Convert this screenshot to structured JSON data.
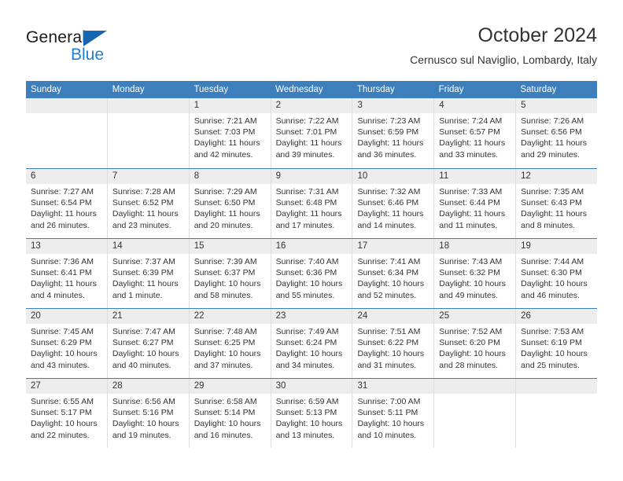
{
  "brand": {
    "name_dark": "General",
    "name_blue": "Blue",
    "accent_color": "#1565b0",
    "blue_color": "#1e7fd4"
  },
  "header": {
    "title": "October 2024",
    "subtitle": "Cernusco sul Naviglio, Lombardy, Italy"
  },
  "calendar": {
    "header_bg": "#3d7ebd",
    "daynum_bg": "#ededed",
    "weekday_headers": [
      "Sunday",
      "Monday",
      "Tuesday",
      "Wednesday",
      "Thursday",
      "Friday",
      "Saturday"
    ],
    "weeks": [
      [
        {
          "day": "",
          "sunrise": "",
          "sunset": "",
          "daylight1": "",
          "daylight2": ""
        },
        {
          "day": "",
          "sunrise": "",
          "sunset": "",
          "daylight1": "",
          "daylight2": ""
        },
        {
          "day": "1",
          "sunrise": "Sunrise: 7:21 AM",
          "sunset": "Sunset: 7:03 PM",
          "daylight1": "Daylight: 11 hours",
          "daylight2": "and 42 minutes."
        },
        {
          "day": "2",
          "sunrise": "Sunrise: 7:22 AM",
          "sunset": "Sunset: 7:01 PM",
          "daylight1": "Daylight: 11 hours",
          "daylight2": "and 39 minutes."
        },
        {
          "day": "3",
          "sunrise": "Sunrise: 7:23 AM",
          "sunset": "Sunset: 6:59 PM",
          "daylight1": "Daylight: 11 hours",
          "daylight2": "and 36 minutes."
        },
        {
          "day": "4",
          "sunrise": "Sunrise: 7:24 AM",
          "sunset": "Sunset: 6:57 PM",
          "daylight1": "Daylight: 11 hours",
          "daylight2": "and 33 minutes."
        },
        {
          "day": "5",
          "sunrise": "Sunrise: 7:26 AM",
          "sunset": "Sunset: 6:56 PM",
          "daylight1": "Daylight: 11 hours",
          "daylight2": "and 29 minutes."
        }
      ],
      [
        {
          "day": "6",
          "sunrise": "Sunrise: 7:27 AM",
          "sunset": "Sunset: 6:54 PM",
          "daylight1": "Daylight: 11 hours",
          "daylight2": "and 26 minutes."
        },
        {
          "day": "7",
          "sunrise": "Sunrise: 7:28 AM",
          "sunset": "Sunset: 6:52 PM",
          "daylight1": "Daylight: 11 hours",
          "daylight2": "and 23 minutes."
        },
        {
          "day": "8",
          "sunrise": "Sunrise: 7:29 AM",
          "sunset": "Sunset: 6:50 PM",
          "daylight1": "Daylight: 11 hours",
          "daylight2": "and 20 minutes."
        },
        {
          "day": "9",
          "sunrise": "Sunrise: 7:31 AM",
          "sunset": "Sunset: 6:48 PM",
          "daylight1": "Daylight: 11 hours",
          "daylight2": "and 17 minutes."
        },
        {
          "day": "10",
          "sunrise": "Sunrise: 7:32 AM",
          "sunset": "Sunset: 6:46 PM",
          "daylight1": "Daylight: 11 hours",
          "daylight2": "and 14 minutes."
        },
        {
          "day": "11",
          "sunrise": "Sunrise: 7:33 AM",
          "sunset": "Sunset: 6:44 PM",
          "daylight1": "Daylight: 11 hours",
          "daylight2": "and 11 minutes."
        },
        {
          "day": "12",
          "sunrise": "Sunrise: 7:35 AM",
          "sunset": "Sunset: 6:43 PM",
          "daylight1": "Daylight: 11 hours",
          "daylight2": "and 8 minutes."
        }
      ],
      [
        {
          "day": "13",
          "sunrise": "Sunrise: 7:36 AM",
          "sunset": "Sunset: 6:41 PM",
          "daylight1": "Daylight: 11 hours",
          "daylight2": "and 4 minutes."
        },
        {
          "day": "14",
          "sunrise": "Sunrise: 7:37 AM",
          "sunset": "Sunset: 6:39 PM",
          "daylight1": "Daylight: 11 hours",
          "daylight2": "and 1 minute."
        },
        {
          "day": "15",
          "sunrise": "Sunrise: 7:39 AM",
          "sunset": "Sunset: 6:37 PM",
          "daylight1": "Daylight: 10 hours",
          "daylight2": "and 58 minutes."
        },
        {
          "day": "16",
          "sunrise": "Sunrise: 7:40 AM",
          "sunset": "Sunset: 6:36 PM",
          "daylight1": "Daylight: 10 hours",
          "daylight2": "and 55 minutes."
        },
        {
          "day": "17",
          "sunrise": "Sunrise: 7:41 AM",
          "sunset": "Sunset: 6:34 PM",
          "daylight1": "Daylight: 10 hours",
          "daylight2": "and 52 minutes."
        },
        {
          "day": "18",
          "sunrise": "Sunrise: 7:43 AM",
          "sunset": "Sunset: 6:32 PM",
          "daylight1": "Daylight: 10 hours",
          "daylight2": "and 49 minutes."
        },
        {
          "day": "19",
          "sunrise": "Sunrise: 7:44 AM",
          "sunset": "Sunset: 6:30 PM",
          "daylight1": "Daylight: 10 hours",
          "daylight2": "and 46 minutes."
        }
      ],
      [
        {
          "day": "20",
          "sunrise": "Sunrise: 7:45 AM",
          "sunset": "Sunset: 6:29 PM",
          "daylight1": "Daylight: 10 hours",
          "daylight2": "and 43 minutes."
        },
        {
          "day": "21",
          "sunrise": "Sunrise: 7:47 AM",
          "sunset": "Sunset: 6:27 PM",
          "daylight1": "Daylight: 10 hours",
          "daylight2": "and 40 minutes."
        },
        {
          "day": "22",
          "sunrise": "Sunrise: 7:48 AM",
          "sunset": "Sunset: 6:25 PM",
          "daylight1": "Daylight: 10 hours",
          "daylight2": "and 37 minutes."
        },
        {
          "day": "23",
          "sunrise": "Sunrise: 7:49 AM",
          "sunset": "Sunset: 6:24 PM",
          "daylight1": "Daylight: 10 hours",
          "daylight2": "and 34 minutes."
        },
        {
          "day": "24",
          "sunrise": "Sunrise: 7:51 AM",
          "sunset": "Sunset: 6:22 PM",
          "daylight1": "Daylight: 10 hours",
          "daylight2": "and 31 minutes."
        },
        {
          "day": "25",
          "sunrise": "Sunrise: 7:52 AM",
          "sunset": "Sunset: 6:20 PM",
          "daylight1": "Daylight: 10 hours",
          "daylight2": "and 28 minutes."
        },
        {
          "day": "26",
          "sunrise": "Sunrise: 7:53 AM",
          "sunset": "Sunset: 6:19 PM",
          "daylight1": "Daylight: 10 hours",
          "daylight2": "and 25 minutes."
        }
      ],
      [
        {
          "day": "27",
          "sunrise": "Sunrise: 6:55 AM",
          "sunset": "Sunset: 5:17 PM",
          "daylight1": "Daylight: 10 hours",
          "daylight2": "and 22 minutes."
        },
        {
          "day": "28",
          "sunrise": "Sunrise: 6:56 AM",
          "sunset": "Sunset: 5:16 PM",
          "daylight1": "Daylight: 10 hours",
          "daylight2": "and 19 minutes."
        },
        {
          "day": "29",
          "sunrise": "Sunrise: 6:58 AM",
          "sunset": "Sunset: 5:14 PM",
          "daylight1": "Daylight: 10 hours",
          "daylight2": "and 16 minutes."
        },
        {
          "day": "30",
          "sunrise": "Sunrise: 6:59 AM",
          "sunset": "Sunset: 5:13 PM",
          "daylight1": "Daylight: 10 hours",
          "daylight2": "and 13 minutes."
        },
        {
          "day": "31",
          "sunrise": "Sunrise: 7:00 AM",
          "sunset": "Sunset: 5:11 PM",
          "daylight1": "Daylight: 10 hours",
          "daylight2": "and 10 minutes."
        },
        {
          "day": "",
          "sunrise": "",
          "sunset": "",
          "daylight1": "",
          "daylight2": ""
        },
        {
          "day": "",
          "sunrise": "",
          "sunset": "",
          "daylight1": "",
          "daylight2": ""
        }
      ]
    ]
  }
}
